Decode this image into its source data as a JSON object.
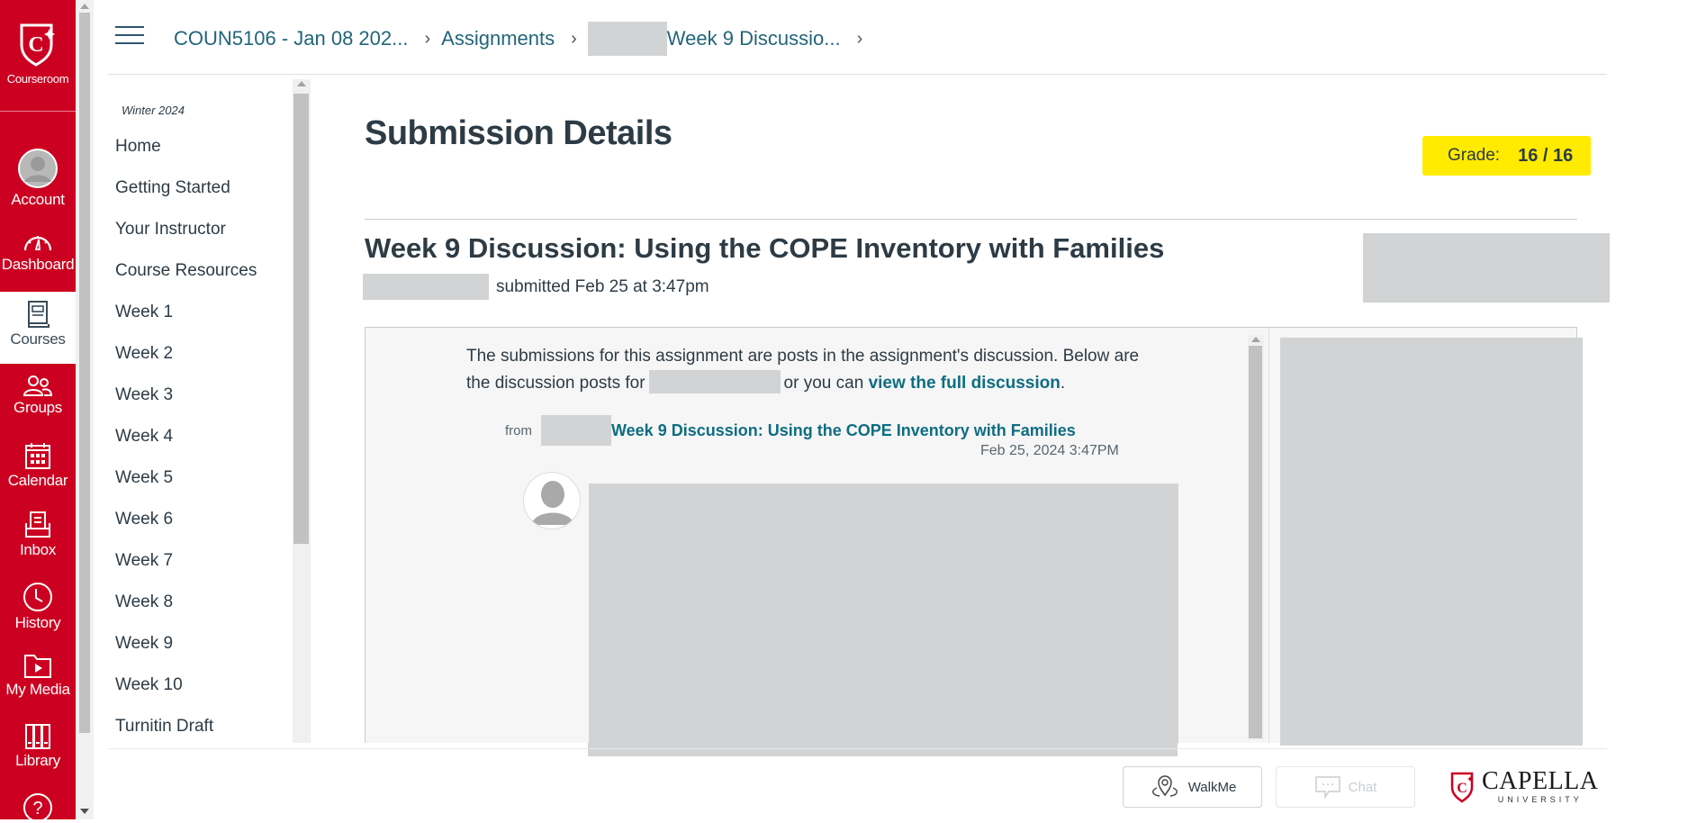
{
  "global_nav": {
    "brand": {
      "label": "Courseroom",
      "icon": "capella-shield-icon"
    },
    "items": [
      {
        "label": "Account",
        "icon": "account-avatar-icon",
        "active": false
      },
      {
        "label": "Dashboard",
        "icon": "dashboard-gauge-icon",
        "active": false
      },
      {
        "label": "Courses",
        "icon": "courses-book-icon",
        "active": true
      },
      {
        "label": "Groups",
        "icon": "groups-people-icon",
        "active": false
      },
      {
        "label": "Calendar",
        "icon": "calendar-icon",
        "active": false
      },
      {
        "label": "Inbox",
        "icon": "inbox-icon",
        "active": false
      },
      {
        "label": "History",
        "icon": "history-clock-icon",
        "active": false
      },
      {
        "label": "My Media",
        "icon": "my-media-folder-icon",
        "active": false
      },
      {
        "label": "Library",
        "icon": "library-books-icon",
        "active": false
      },
      {
        "label": "",
        "icon": "help-question-icon",
        "active": false
      }
    ],
    "colors": {
      "brand_red": "#cc0020"
    }
  },
  "header": {
    "breadcrumb": [
      {
        "label": "COUN5106 - Jan 08 202..."
      },
      {
        "label": "Assignments"
      },
      {
        "label": "Week 9 Discussio...",
        "redacted_prefix": true
      }
    ]
  },
  "course_nav": {
    "term": "Winter 2024",
    "items": [
      "Home",
      "Getting Started",
      "Your Instructor",
      "Course Resources",
      "Week 1",
      "Week 2",
      "Week 3",
      "Week 4",
      "Week 5",
      "Week 6",
      "Week 7",
      "Week 8",
      "Week 9",
      "Week 10",
      "Turnitin Draft"
    ]
  },
  "main": {
    "page_title": "Submission Details",
    "grade": {
      "label": "Grade:",
      "value": "16 / 16",
      "highlight_color": "#ffeb00"
    },
    "assignment_title": "Week 9 Discussion: Using the COPE Inventory with Families",
    "submitted_text": "submitted Feb 25 at 3:47pm",
    "intro_part1": "The submissions for this assignment are posts in the assignment's discussion. Below are the discussion posts for",
    "intro_part2": "or you can",
    "intro_link": "view the full discussion",
    "intro_end": ".",
    "from_label": "from",
    "from_link": "Week 9 Discussion: Using the COPE Inventory with Families",
    "post_date": "Feb 25, 2024 3:47PM",
    "link_color": "#0e6d82"
  },
  "footer": {
    "walkme_label": "WalkMe",
    "chat_label": "Chat",
    "logo_word": "CAPELLA",
    "logo_sub": "UNIVERSITY"
  }
}
